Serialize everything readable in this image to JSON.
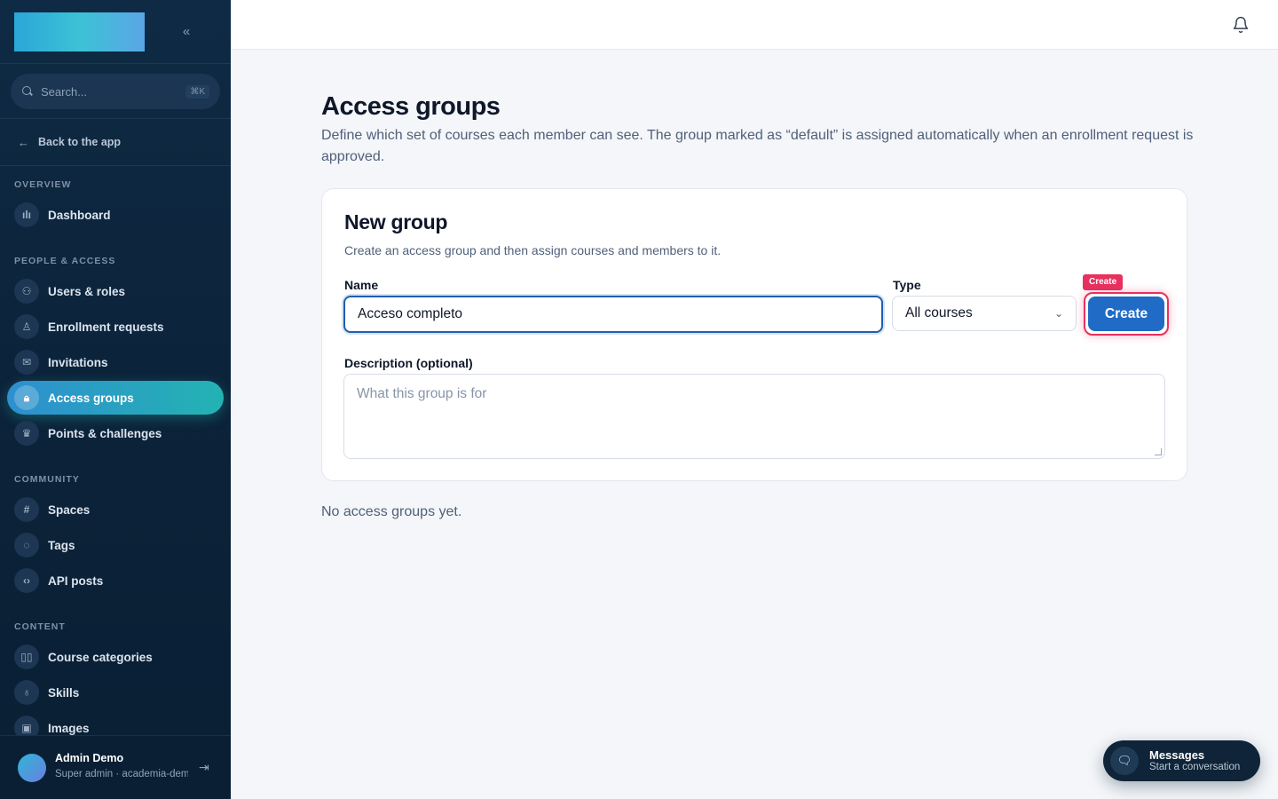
{
  "sidebar": {
    "search_placeholder": "Search...",
    "search_shortcut": "⌘K",
    "back_label": "Back to the app",
    "sections": {
      "overview": "OVERVIEW",
      "people": "PEOPLE & ACCESS",
      "community": "COMMUNITY",
      "content": "CONTENT"
    },
    "items": {
      "dashboard": "Dashboard",
      "users": "Users & roles",
      "enrollment": "Enrollment requests",
      "invitations": "Invitations",
      "access_groups": "Access groups",
      "points": "Points & challenges",
      "spaces": "Spaces",
      "tags": "Tags",
      "api_posts": "API posts",
      "course_categories": "Course categories",
      "skills": "Skills",
      "images": "Images"
    },
    "user": {
      "name": "Admin Demo",
      "role": "Super admin · academia-demo"
    }
  },
  "page": {
    "title": "Access groups",
    "description": "Define which set of courses each member can see. The group marked as “default” is assigned automatically when an enrollment request is approved.",
    "empty_state": "No access groups yet."
  },
  "form": {
    "card_title": "New group",
    "card_subtitle": "Create an access group and then assign courses and members to it.",
    "name_label": "Name",
    "name_value": "Acceso completo",
    "type_label": "Type",
    "type_value": "All courses",
    "create_button": "Create",
    "create_tag": "Create",
    "description_label": "Description (optional)",
    "description_placeholder": "What this group is for"
  },
  "messages_widget": {
    "title": "Messages",
    "subtitle": "Start a conversation"
  },
  "colors": {
    "accent": "#1f6bc6",
    "highlight": "#e7315e",
    "sidebar_bg": "#0f2a44"
  }
}
